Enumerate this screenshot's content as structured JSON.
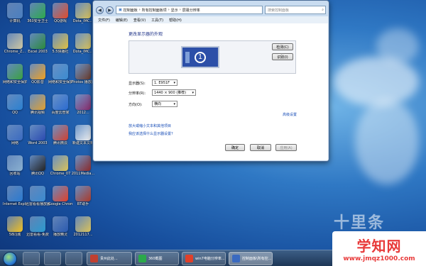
{
  "desktop": {
    "icons": [
      {
        "label": "计算机",
        "color": "#4a7fbf"
      },
      {
        "label": "360安全卫士",
        "color": "#2ba94a"
      },
      {
        "label": "QQ游戏",
        "color": "#e24a2a"
      },
      {
        "label": "Dota_IMC...",
        "color": "#d9c25a"
      },
      {
        "label": "Chrome_Z...",
        "color": "#cfc7a0"
      },
      {
        "label": "Excel 2003",
        "color": "#2a8a3a"
      },
      {
        "label": "5.5快播社",
        "color": "#e0c040"
      },
      {
        "label": "Dota_IMC...",
        "color": "#d9c25a"
      },
      {
        "label": "网络和安全保护卫士",
        "color": "#3aa040"
      },
      {
        "label": "QQ影音",
        "color": "#f0a020"
      },
      {
        "label": "网络和安全保护卫士",
        "color": "#3a8ad0"
      },
      {
        "label": "Photos 播放器",
        "color": "#6a3a2a"
      },
      {
        "label": "QQ",
        "color": "#2a80d0"
      },
      {
        "label": "腾讯视频",
        "color": "#e0a030"
      },
      {
        "label": "百度云管家",
        "color": "#2a6ad0"
      },
      {
        "label": "2012...",
        "color": "#8a2a6a"
      },
      {
        "label": "网络",
        "color": "#3a6ac0"
      },
      {
        "label": "Word 2003",
        "color": "#2a4ab0"
      },
      {
        "label": "腾讯微云",
        "color": "#d04030"
      },
      {
        "label": "新建文本文档",
        "color": "#f0f0f0"
      },
      {
        "label": "回收站",
        "color": "#8ab0d0"
      },
      {
        "label": "腾讯QQ",
        "color": "#222222"
      },
      {
        "label": "Chrome_07",
        "color": "#d9c25a"
      },
      {
        "label": "2011Media...",
        "color": "#8a2a2a"
      },
      {
        "label": "Internet Explorer",
        "color": "#2a7ad0"
      },
      {
        "label": "迅雷看看播放器",
        "color": "#3a8ad0"
      },
      {
        "label": "Google Chrome",
        "color": "#e0402a"
      },
      {
        "label": "BT助手",
        "color": "#aa3a2a"
      },
      {
        "label": "58同城",
        "color": "#f0c020"
      },
      {
        "label": "迅雷看看-免费",
        "color": "#2a9ad0"
      },
      {
        "label": "播放精灵",
        "color": "#2a5ab0"
      },
      {
        "label": "2012117...",
        "color": "#d9c25a"
      }
    ],
    "wallpaper_text": "十里条"
  },
  "window": {
    "breadcrumb": [
      "控制面板",
      "所有控制面板项",
      "显示",
      "屏幕分辨率"
    ],
    "search_placeholder": "搜索控制面板",
    "menu": [
      "文件(F)",
      "编辑(E)",
      "查看(V)",
      "工具(T)",
      "帮助(H)"
    ],
    "heading": "更改显示器的外观",
    "monitor_number": "1",
    "detect_label": "检测(C)",
    "identify_label": "识别(I)",
    "display_label": "显示器(S):",
    "display_value": "1. E951F",
    "resolution_label": "分辨率(R):",
    "resolution_value": "1440 × 900 (推荐)",
    "orientation_label": "方向(O):",
    "orientation_value": "横向",
    "advanced_link": "高级设置",
    "link1": "放大或缩小文本和其他项目",
    "link2": "我应该选择什么显示器设置?",
    "ok_label": "确定",
    "cancel_label": "取消",
    "apply_label": "应用(A)"
  },
  "taskbar": {
    "tasks": [
      {
        "label": "贵州此处...",
        "color": "#c04030"
      },
      {
        "label": "360截图",
        "color": "#2ba94a"
      },
      {
        "label": "win7电脑分辨率...",
        "color": "#e0402a"
      },
      {
        "label": "控制面板\\所有控...",
        "color": "#3a6ac0"
      }
    ]
  },
  "watermark": {
    "line1": "学知网",
    "line2": "www.jmqz1000.com"
  }
}
